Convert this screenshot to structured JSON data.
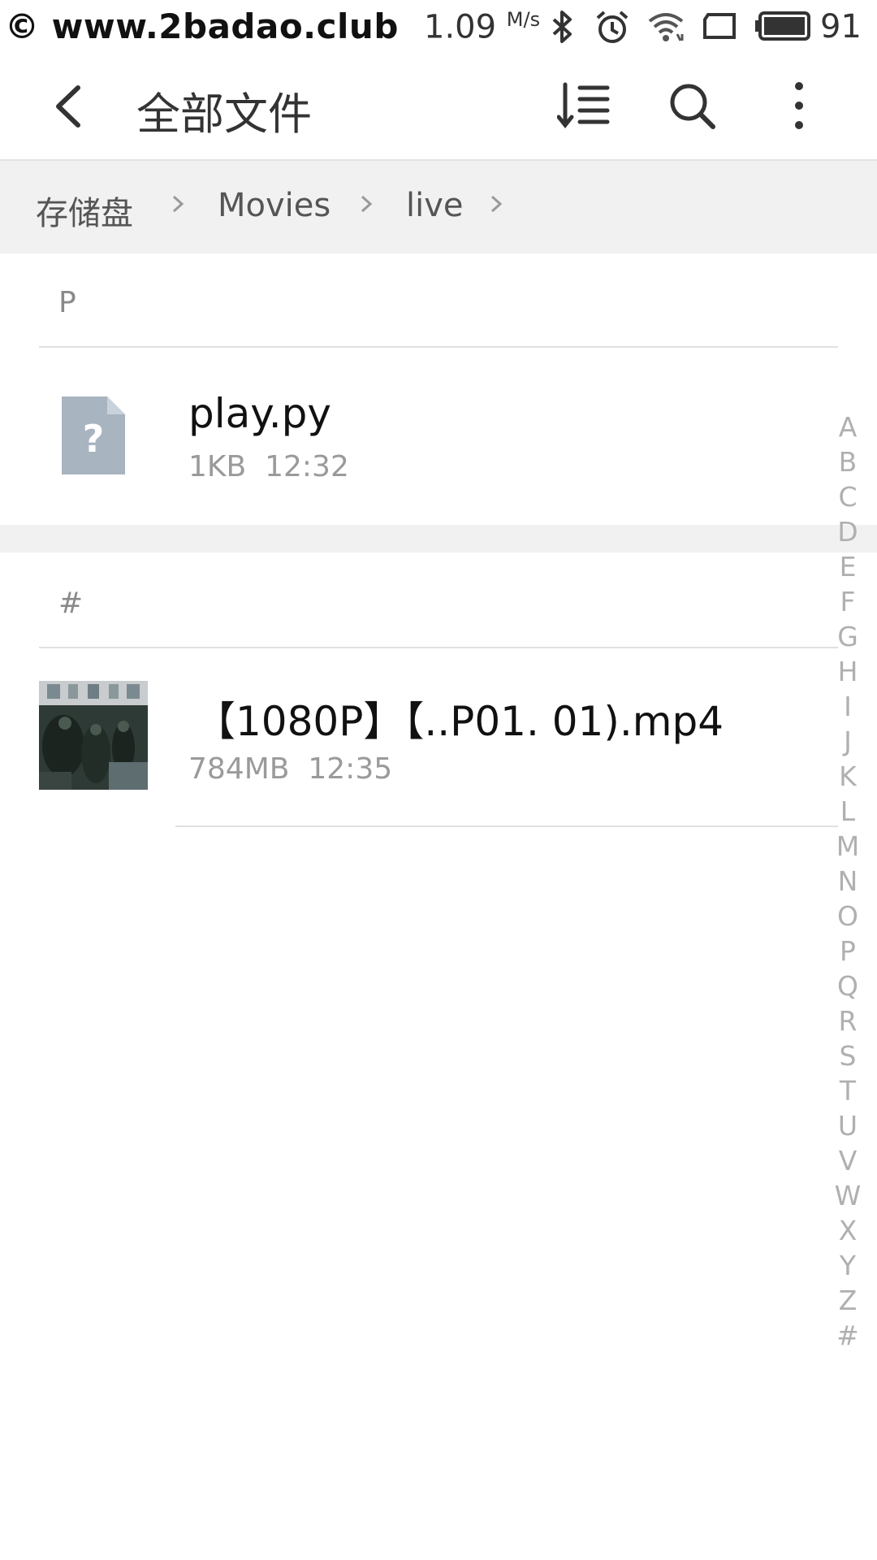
{
  "status_bar": {
    "watermark": "© www.2badao.club",
    "speed_value": "1.09",
    "speed_unit": "M/s",
    "battery_percent": "91",
    "icons": [
      "bluetooth-icon",
      "alarm-icon",
      "wifi-icon",
      "screen-icon",
      "battery-icon"
    ]
  },
  "titlebar": {
    "title": "全部文件",
    "icons": [
      "back-arrow-icon",
      "sort-icon",
      "search-icon",
      "more-vertical-icon"
    ]
  },
  "breadcrumb": {
    "items": [
      "存储盘",
      "Movies",
      "live"
    ]
  },
  "sections": [
    {
      "header": "P",
      "files": [
        {
          "name": "play.py",
          "size": "1KB",
          "time": "12:32",
          "icon": "unknown-file-icon"
        }
      ]
    },
    {
      "header": "#",
      "files": [
        {
          "name": "【1080P】【..P01. 01).mp4",
          "size": "784MB",
          "time": "12:35",
          "icon": "video-thumbnail"
        }
      ]
    }
  ],
  "index_letters": [
    "A",
    "B",
    "C",
    "D",
    "E",
    "F",
    "G",
    "H",
    "I",
    "J",
    "K",
    "L",
    "M",
    "N",
    "O",
    "P",
    "Q",
    "R",
    "S",
    "T",
    "U",
    "V",
    "W",
    "X",
    "Y",
    "Z",
    "#"
  ],
  "colors": {
    "band": "#f1f1f1",
    "unknown_file": "#a8b4c0",
    "index": "#b0b0b0"
  }
}
